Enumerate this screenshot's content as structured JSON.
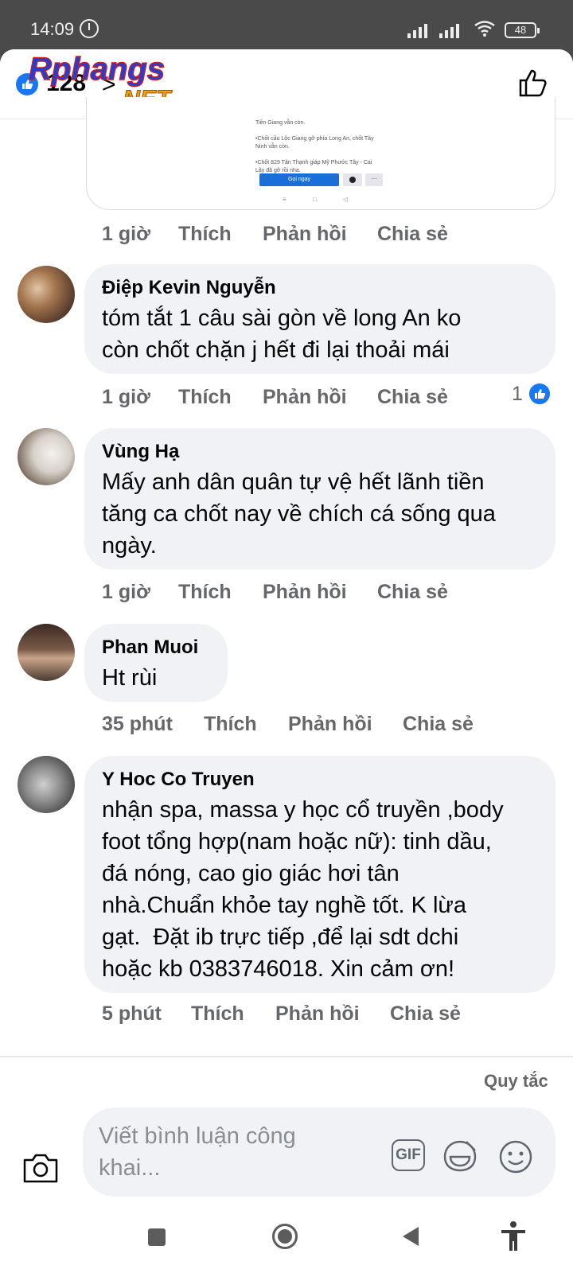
{
  "status_bar": {
    "time": "14:09",
    "battery": "48"
  },
  "header": {
    "reaction_count": "128",
    "chevron": ">",
    "watermark": {
      "line1": "Rphangs",
      "line2": ".NET"
    }
  },
  "shared_post": {
    "lines": [
      "Tiền Giang vẫn còn.",
      "•Chốt cầu Lộc Giang gỡ phía Long An, chốt Tây",
      "Ninh vẫn còn.",
      "•Chốt 829 Tân Thạnh giáp Mỹ Phước Tây - Cai",
      "Lậy đã gỡ rồi nha."
    ],
    "call_button": "Gọi ngay",
    "more": "···"
  },
  "actions": {
    "like": "Thích",
    "reply": "Phản hồi",
    "share": "Chia sẻ"
  },
  "post_time": "1 giờ",
  "comments": [
    {
      "author": "Điệp Kevin Nguyễn",
      "text": "tóm tắt 1 câu sài gòn về long An ko\ncòn chốt chặn j hết đi lại thoải mái",
      "time": "1 giờ",
      "reactions": "1"
    },
    {
      "author": "Vùng Hạ",
      "text": "Mấy anh dân quân tự vệ hết lãnh tiền\ntăng ca chốt nay về chích cá sống qua\nngày.",
      "time": "1 giờ"
    },
    {
      "author": "Phan Muoi",
      "text": "Ht rùi",
      "time": "35 phút"
    },
    {
      "author": "Y Hoc Co Truyen",
      "text": "nhận spa, massa y học cổ truyền ,body\nfoot tổng hợp(nam hoặc nữ): tinh dầu,\nđá nóng, cao gio giác hơi tân\nnhà.Chuẩn khỏe tay nghề tốt. K lừa\ngạt.  Đặt ib trực tiếp ,để lại sdt dchi\nhoặc kb 0383746018. Xin cảm ơn!",
      "time": "5 phút"
    }
  ],
  "footer": {
    "rules": "Quy tắc",
    "placeholder": "Viết bình luận công khai...",
    "gif": "GIF"
  },
  "colors": {
    "accent": "#1877f2",
    "bubble": "#f0f2f5",
    "meta": "#65676b"
  }
}
